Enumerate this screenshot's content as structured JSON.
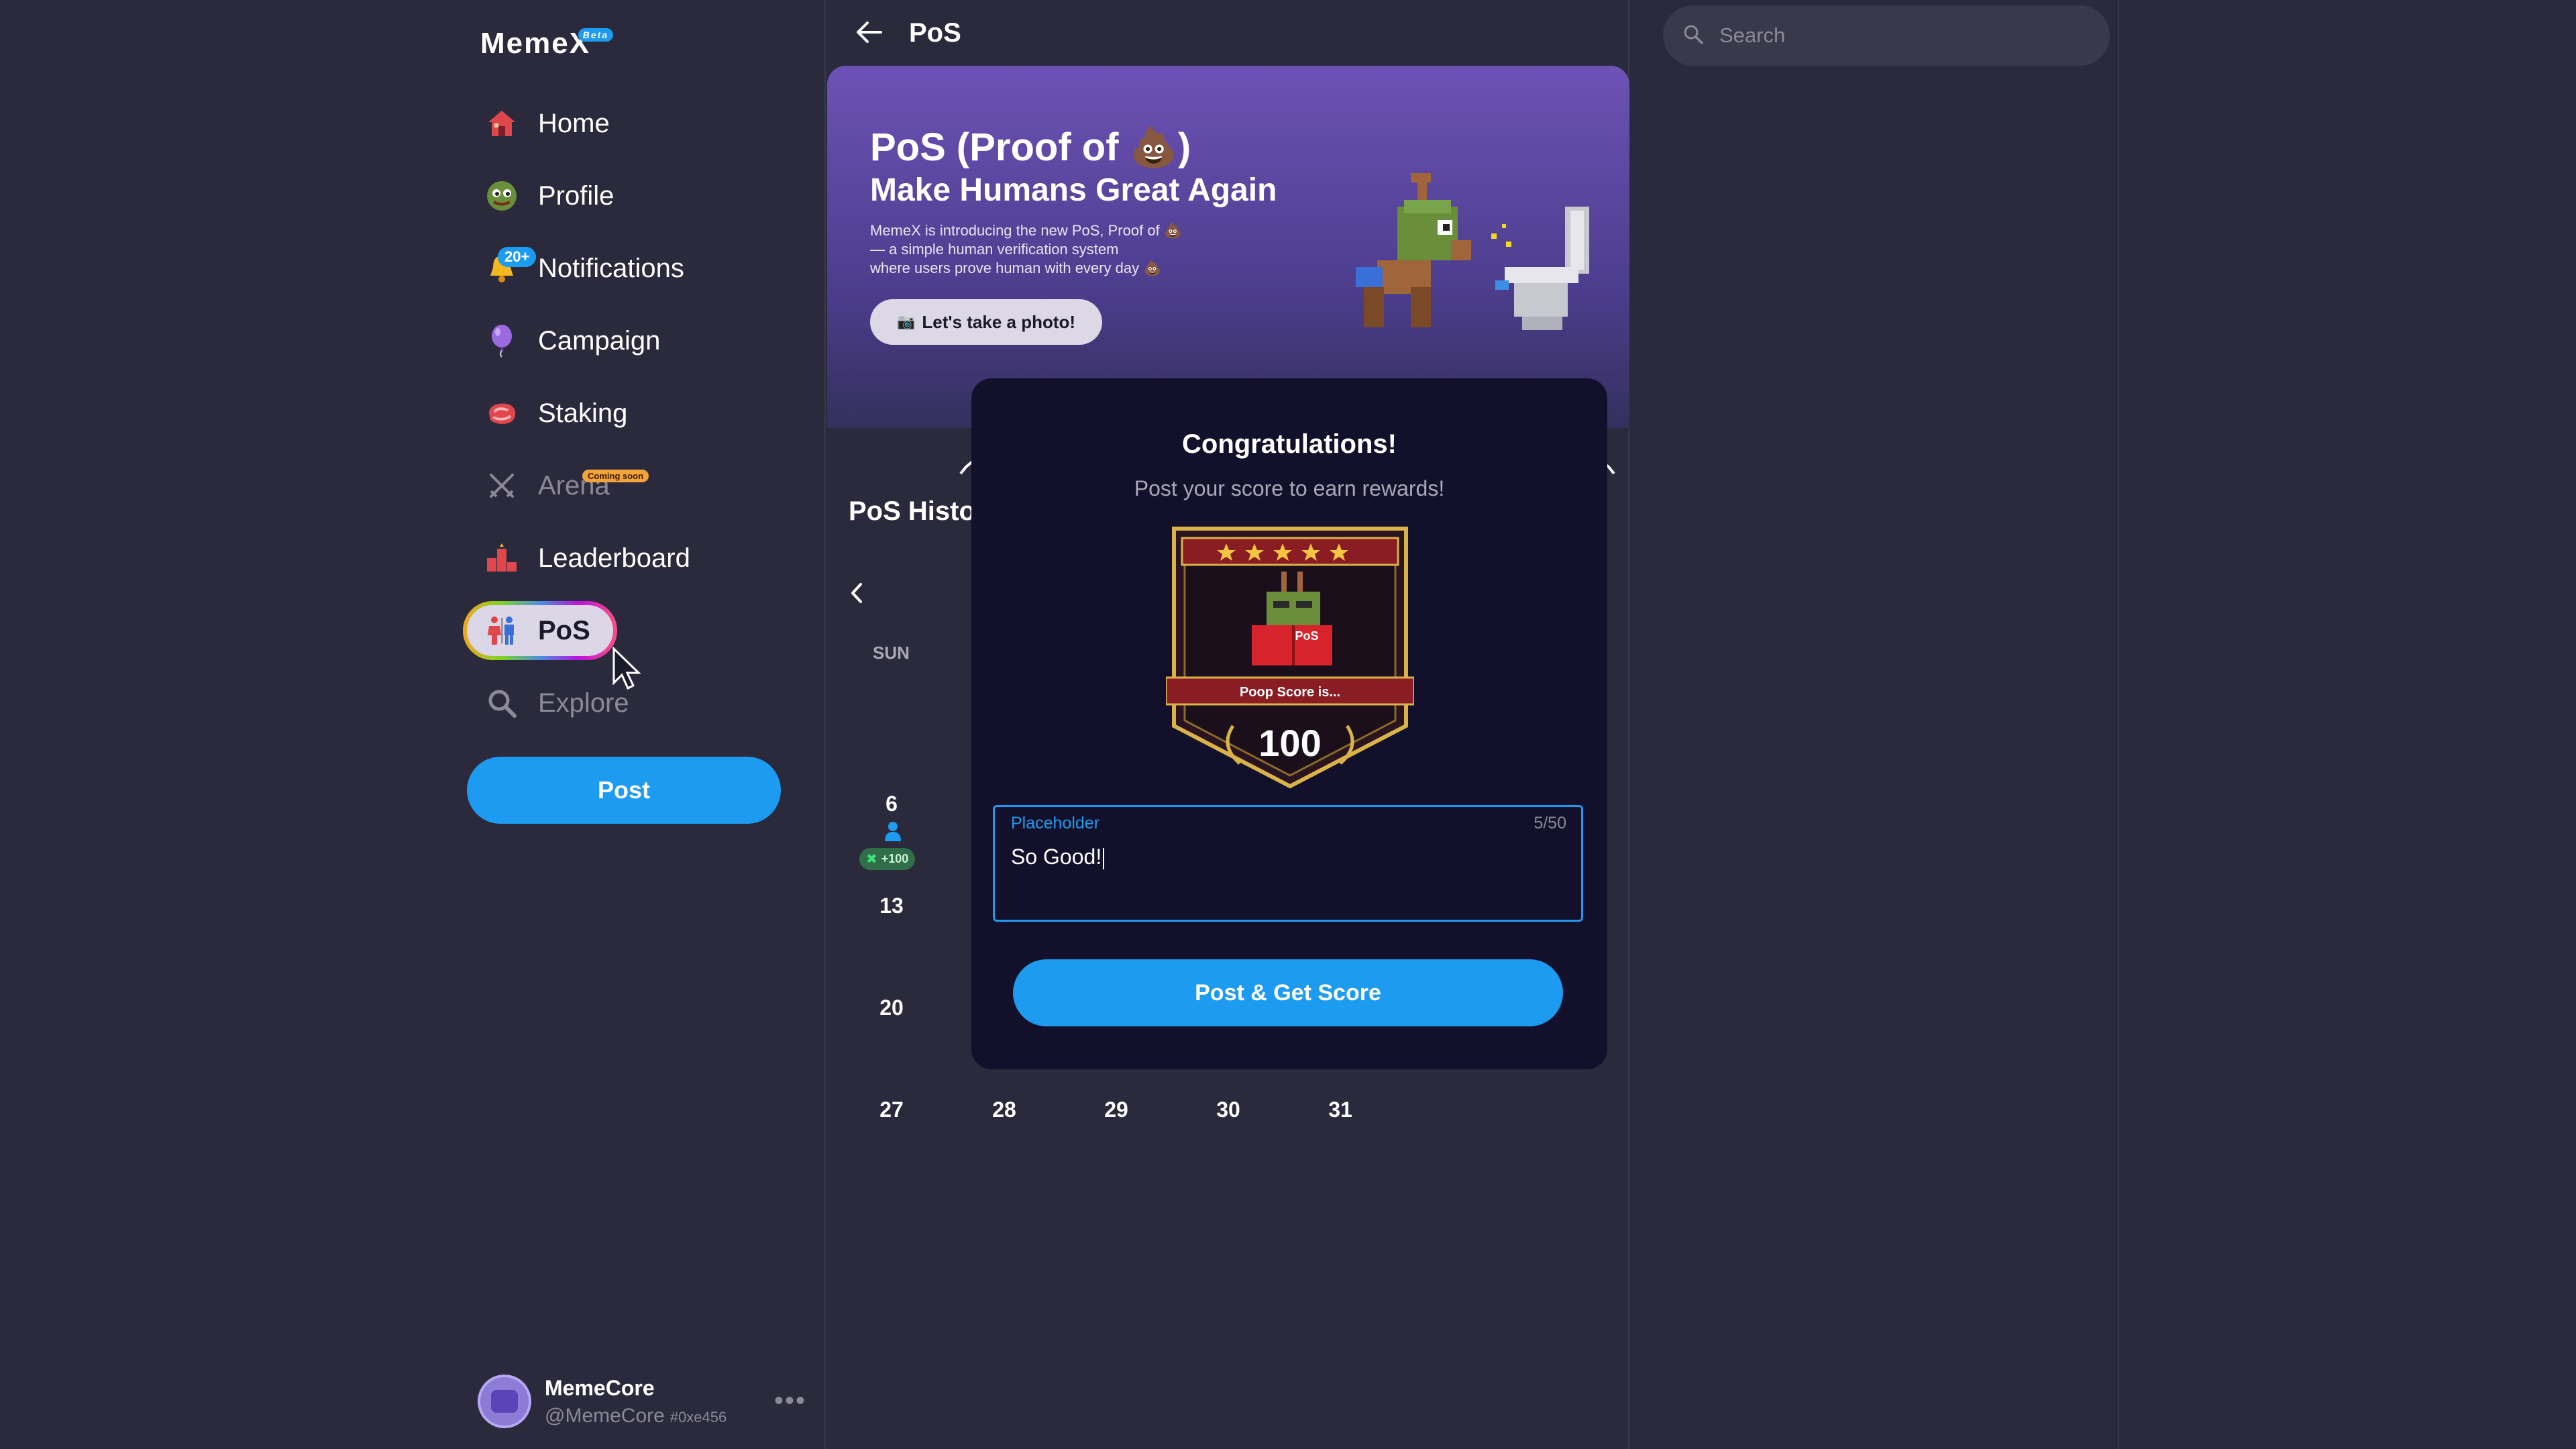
{
  "app": {
    "logo_text": "MemeX",
    "beta_label": "Beta"
  },
  "sidebar": {
    "items": [
      {
        "label": "Home",
        "icon": "home-icon"
      },
      {
        "label": "Profile",
        "icon": "profile-frog-icon"
      },
      {
        "label": "Notifications",
        "icon": "bell-icon",
        "badge": "20+"
      },
      {
        "label": "Campaign",
        "icon": "balloon-icon"
      },
      {
        "label": "Staking",
        "icon": "steak-icon"
      },
      {
        "label": "Arena",
        "icon": "crossed-swords-icon",
        "badge": "Coming soon",
        "disabled": true
      },
      {
        "label": "Leaderboard",
        "icon": "podium-icon"
      },
      {
        "label": "PoS",
        "icon": "restroom-icon",
        "active": true
      },
      {
        "label": "Explore",
        "icon": "search-icon",
        "disabled": true
      }
    ],
    "post_button": "Post",
    "account": {
      "name": "MemeCore",
      "handle": "@MemeCore",
      "tag": "#0xe456",
      "more": "•••"
    }
  },
  "header": {
    "title": "PoS"
  },
  "hero": {
    "title": "PoS (Proof of 💩)",
    "subtitle": "Make Humans Great Again",
    "desc_line1": "MemeX is introducing the new PoS, Proof of 💩",
    "desc_line2": "— a simple human verification system",
    "desc_line3": "where users prove human with every day 💩",
    "photo_button": "Let's take a photo!"
  },
  "history": {
    "title": "PoS History",
    "weekday": "SUN",
    "days": [
      "6",
      "13",
      "20",
      "27",
      "28",
      "29",
      "30",
      "31"
    ],
    "reward": "+100"
  },
  "modal": {
    "title": "Congratulations!",
    "subtitle": "Post your score to earn rewards!",
    "badge": {
      "ribbon": "Poop Score is...",
      "score": "100",
      "book_label": "PoS",
      "stars": 5
    },
    "field": {
      "label": "Placeholder",
      "value": "So Good!",
      "counter": "5/50"
    },
    "submit": "Post & Get Score"
  },
  "search": {
    "placeholder": "Search"
  },
  "colors": {
    "accent": "#1d9bf0",
    "background": "#2b2a3d",
    "modal": "#12102a",
    "hero": "#6d52b5"
  }
}
